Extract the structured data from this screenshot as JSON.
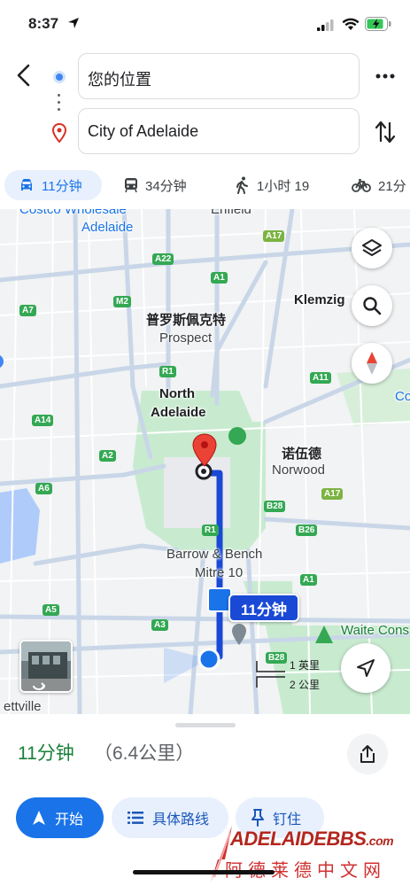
{
  "status_bar": {
    "time": "8:37"
  },
  "search": {
    "origin": "您的位置",
    "destination": "City of Adelaide"
  },
  "modes": [
    {
      "label": "11分钟",
      "icon": "car-icon",
      "active": true
    },
    {
      "label": "34分钟",
      "icon": "transit-icon",
      "active": false
    },
    {
      "label": "1小时 19",
      "icon": "walk-icon",
      "active": false
    },
    {
      "label": "21分",
      "icon": "bike-icon",
      "active": false
    }
  ],
  "map": {
    "labels": {
      "costco_1": "Costco Wholesale",
      "costco_2": "Adelaide",
      "enfield": "Enfield",
      "prospect_cn": "普罗斯佩克特",
      "prospect": "Prospect",
      "klemzig": "Klemzig",
      "north_adelaide_1": "North",
      "north_adelaide_2": "Adelaide",
      "norwood_cn": "诺伍德",
      "norwood": "Norwood",
      "barrow_1": "Barrow & Bench",
      "barrow_2": "Mitre 10",
      "waite": "Waite Cons",
      "edge_co": "Co",
      "ettville": "ettville"
    },
    "shields": {
      "a17_top": "A17",
      "a22": "A22",
      "a1_top": "A1",
      "a7": "A7",
      "m2": "M2",
      "r1_top": "R1",
      "a11": "A11",
      "a14": "A14",
      "a2": "A2",
      "a6": "A6",
      "b28_mid": "B28",
      "a17_mid": "A17",
      "r1_mid": "R1",
      "b26": "B26",
      "a1_low": "A1",
      "a5": "A5",
      "a3": "A3",
      "b28_low": "B28"
    },
    "route_eta": "11分钟",
    "scale": {
      "imperial": "1 英里",
      "metric": "2 公里"
    },
    "colors": {
      "route": "#1a49d6",
      "park": "#c8ebcf",
      "road": "#ffffff",
      "major_road": "#c9d6e8"
    }
  },
  "sheet": {
    "eta": "11分钟",
    "distance": "（6.4公里）",
    "buttons": {
      "start": "开始",
      "steps": "具体路线",
      "pin": "钉住"
    }
  },
  "watermark": {
    "brand": "ADELAIDEBBS",
    "suffix": ".com",
    "cn": "阿德莱德中文网"
  }
}
